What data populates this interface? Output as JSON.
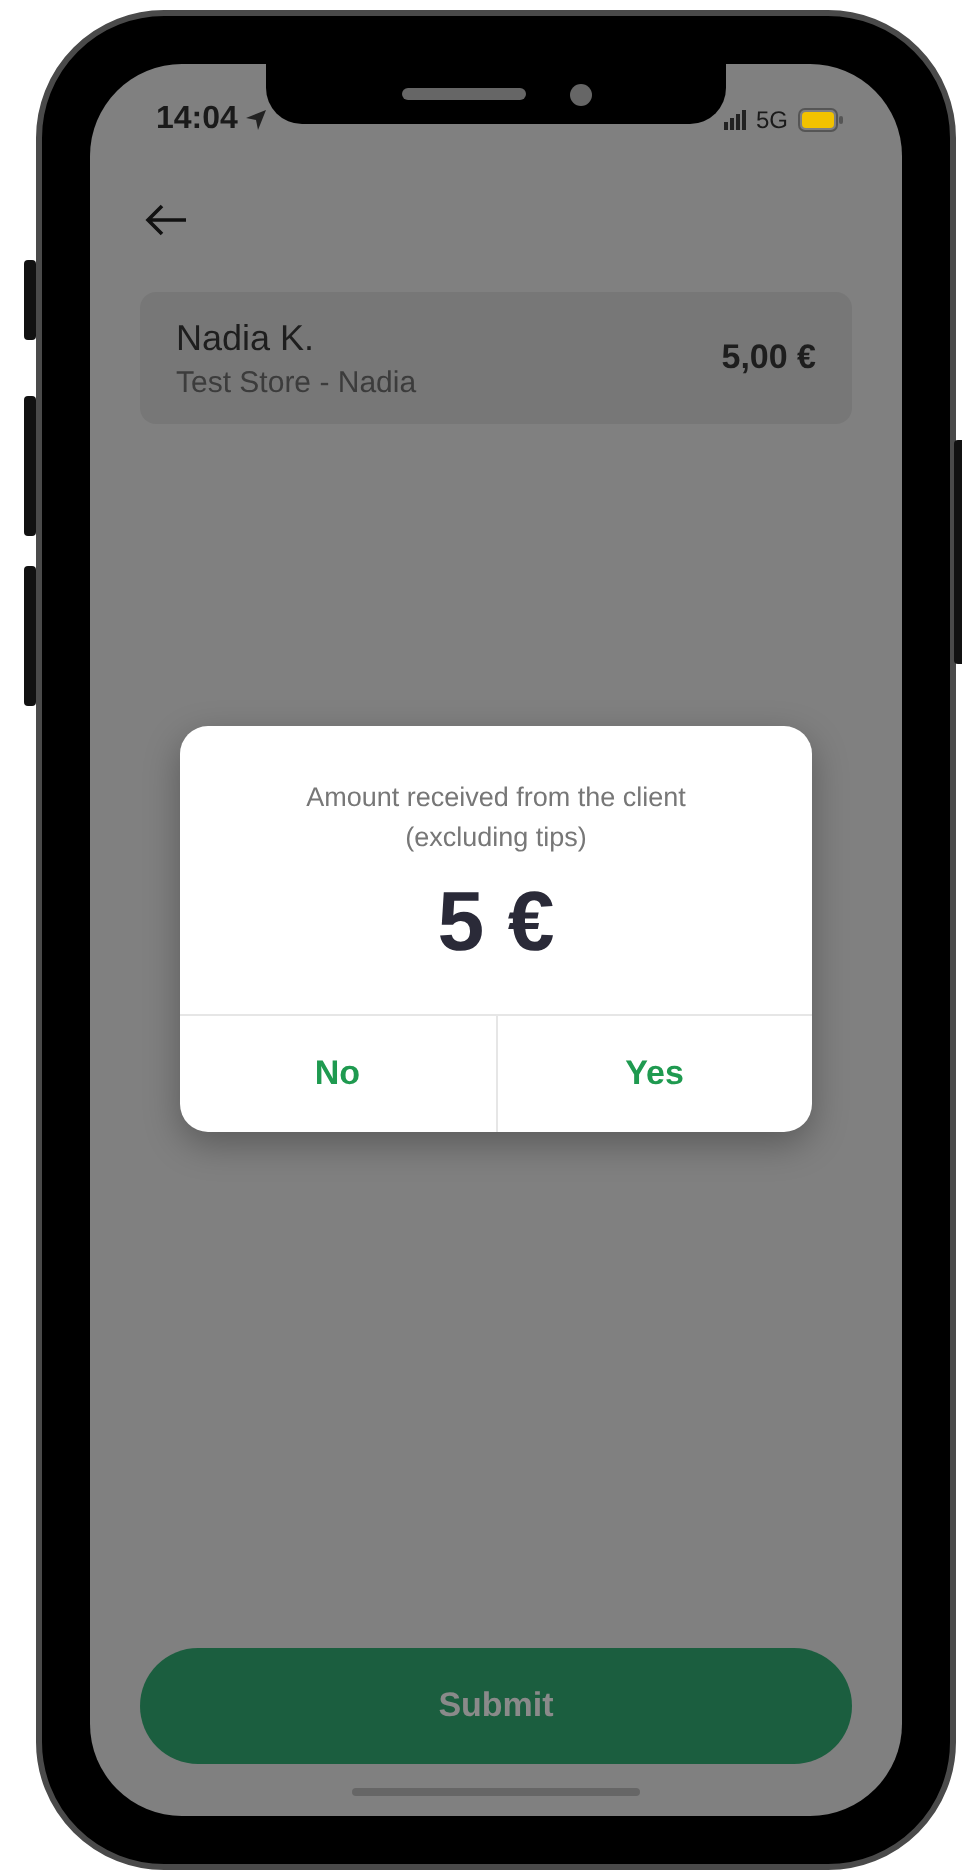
{
  "status_bar": {
    "time": "14:04",
    "network": "5G"
  },
  "order_card": {
    "customer": "Nadia K.",
    "store": "Test Store - Nadia",
    "amount": "5,00 €"
  },
  "dialog": {
    "message": "Amount received from the client (excluding tips)",
    "amount": "5 €",
    "buttons": [
      {
        "label": "No"
      },
      {
        "label": "Yes"
      }
    ]
  },
  "submit_button": {
    "label": "Submit"
  }
}
